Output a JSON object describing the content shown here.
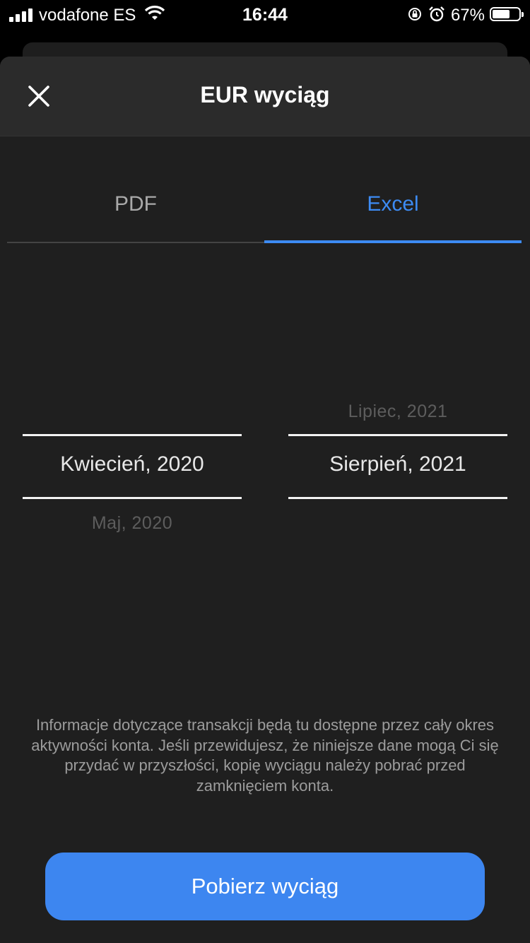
{
  "status_bar": {
    "carrier": "vodafone ES",
    "time": "16:44",
    "battery_percent": "67%",
    "battery_level": 0.67,
    "icons": [
      "signal-icon",
      "wifi-icon",
      "orientation-lock-icon",
      "alarm-icon",
      "battery-icon"
    ]
  },
  "sheet": {
    "title": "EUR wyciąg",
    "close_icon": "close-icon",
    "tabs": [
      {
        "label": "PDF",
        "active": false
      },
      {
        "label": "Excel",
        "active": true
      }
    ],
    "from_picker": {
      "previous": "",
      "selected": "Kwiecień, 2020",
      "next": "Maj, 2020"
    },
    "to_picker": {
      "previous": "Lipiec, 2021",
      "selected": "Sierpień, 2021",
      "next": ""
    },
    "info_text": "Informacje dotyczące transakcji będą tu dostępne przez cały okres aktywności konta. Jeśli przewidujesz, że niniejsze dane mogą Ci się przydać w przyszłości, kopię wyciągu należy pobrać przed zamknięciem konta.",
    "download_button": "Pobierz wyciąg"
  },
  "colors": {
    "accent": "#3d8bf3",
    "button": "#3d86f0",
    "sheet_background": "#1f1f1f",
    "header_background": "#2b2b2b"
  }
}
